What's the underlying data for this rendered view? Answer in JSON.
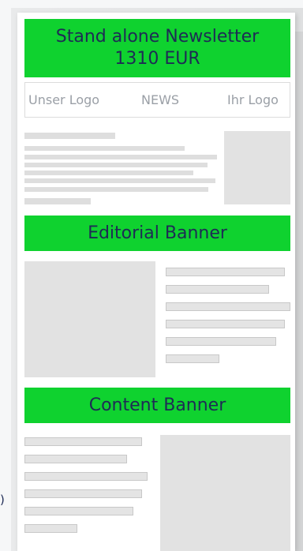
{
  "top_banner": {
    "line1": "Stand alone Newsletter",
    "line2": "1310 EUR"
  },
  "header": {
    "left_logo": "Unser Logo",
    "center": "NEWS",
    "right_logo": "Ihr Logo"
  },
  "editorial_banner": {
    "label": "Editorial Banner"
  },
  "content_banner": {
    "label": "Content Banner"
  },
  "footer_fragment": ")",
  "colors": {
    "banner_green": "#0fd22f",
    "banner_text": "#1e2b55",
    "placeholder_gray": "#e2e2e2"
  }
}
